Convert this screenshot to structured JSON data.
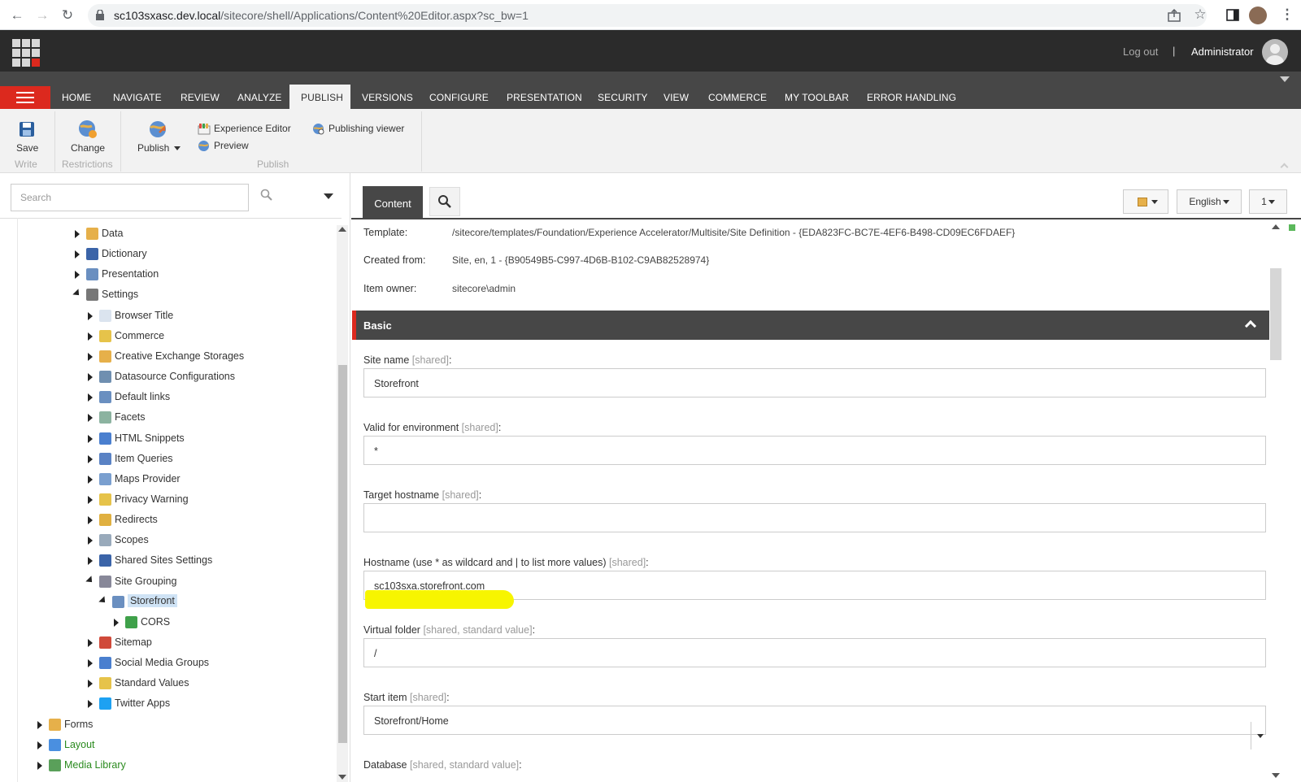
{
  "browser": {
    "url_host": "sc103sxasc.dev.local",
    "url_path": "/sitecore/shell/Applications/Content%20Editor.aspx?sc_bw=1"
  },
  "header": {
    "logout": "Log out",
    "separator": "|",
    "user": "Administrator"
  },
  "ribbon": {
    "tabs": [
      "HOME",
      "NAVIGATE",
      "REVIEW",
      "ANALYZE",
      "PUBLISH",
      "VERSIONS",
      "CONFIGURE",
      "PRESENTATION",
      "SECURITY",
      "VIEW",
      "COMMERCE",
      "MY TOOLBAR",
      "ERROR HANDLING"
    ],
    "active_tab": "PUBLISH",
    "save": "Save",
    "change": "Change",
    "publish": "Publish",
    "experience_editor": "Experience Editor",
    "preview": "Preview",
    "publishing_viewer": "Publishing viewer",
    "groups": {
      "write": "Write",
      "restrictions": "Restrictions",
      "publish": "Publish"
    }
  },
  "tree": {
    "search_placeholder": "Search",
    "nodes": [
      {
        "label": "Data",
        "icon": "data-icon"
      },
      {
        "label": "Dictionary",
        "icon": "dictionary-icon"
      },
      {
        "label": "Presentation",
        "icon": "presentation-icon"
      },
      {
        "label": "Settings",
        "icon": "settings-icon"
      },
      {
        "label": "Browser Title",
        "icon": "browser-title-icon"
      },
      {
        "label": "Commerce",
        "icon": "commerce-icon"
      },
      {
        "label": "Creative Exchange Storages",
        "icon": "storage-icon"
      },
      {
        "label": "Datasource Configurations",
        "icon": "datasource-icon"
      },
      {
        "label": "Default links",
        "icon": "link-icon"
      },
      {
        "label": "Facets",
        "icon": "facets-icon"
      },
      {
        "label": "HTML Snippets",
        "icon": "html-snippets-icon"
      },
      {
        "label": "Item Queries",
        "icon": "item-queries-icon"
      },
      {
        "label": "Maps Provider",
        "icon": "maps-icon"
      },
      {
        "label": "Privacy Warning",
        "icon": "privacy-icon"
      },
      {
        "label": "Redirects",
        "icon": "redirects-icon"
      },
      {
        "label": "Scopes",
        "icon": "scopes-icon"
      },
      {
        "label": "Shared Sites Settings",
        "icon": "shared-sites-icon"
      },
      {
        "label": "Site Grouping",
        "icon": "site-grouping-icon"
      },
      {
        "label": "Storefront",
        "icon": "site-icon"
      },
      {
        "label": "CORS",
        "icon": "cors-icon"
      },
      {
        "label": "Sitemap",
        "icon": "sitemap-icon"
      },
      {
        "label": "Social Media Groups",
        "icon": "social-icon"
      },
      {
        "label": "Standard Values",
        "icon": "standard-values-icon"
      },
      {
        "label": "Twitter Apps",
        "icon": "twitter-icon"
      },
      {
        "label": "Forms",
        "icon": "forms-icon"
      },
      {
        "label": "Layout",
        "icon": "layout-icon"
      },
      {
        "label": "Media Library",
        "icon": "media-library-icon"
      }
    ]
  },
  "content": {
    "tab_label": "Content",
    "language": "English",
    "version": "1",
    "info": [
      {
        "key": "Template:",
        "value": "/sitecore/templates/Foundation/Experience Accelerator/Multisite/Site Definition - {EDA823FC-BC7E-4EF6-B498-CD09EC6FDAEF}"
      },
      {
        "key": "Created from:",
        "value": "Site, en, 1 - {B90549B5-C997-4D6B-B102-C9AB82528974}"
      },
      {
        "key": "Item owner:",
        "value": "sitecore\\admin"
      }
    ],
    "section": "Basic",
    "fields": [
      {
        "label": "Site name",
        "tag": "[shared]",
        "value": "Storefront"
      },
      {
        "label": "Valid for environment",
        "tag": "[shared]",
        "value": "*"
      },
      {
        "label": "Target hostname",
        "tag": "[shared]",
        "value": ""
      },
      {
        "label": "Hostname (use * as wildcard and | to list more values)",
        "tag": "[shared]",
        "value": "sc103sxa.storefront.com"
      },
      {
        "label": "Virtual folder",
        "tag": "[shared, standard value]",
        "value": "/"
      },
      {
        "label": "Start item",
        "tag": "[shared]",
        "value": "Storefront/Home"
      },
      {
        "label": "Database",
        "tag": "[shared, standard value]",
        "value": ""
      }
    ],
    "colon": ":"
  }
}
